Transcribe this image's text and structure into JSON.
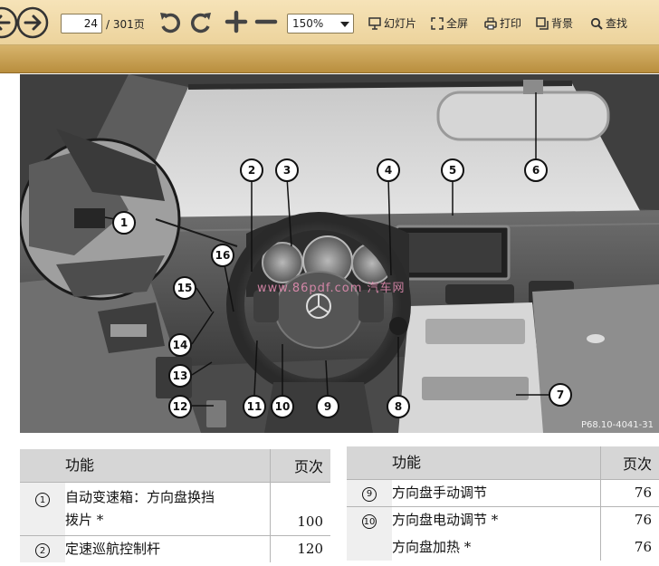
{
  "toolbar": {
    "page_current": "24",
    "page_total_label": "/ 301页",
    "zoom_value": "150%",
    "tools": {
      "slideshow": "幻灯片",
      "fullscreen": "全屏",
      "print": "打印",
      "background": "背景",
      "search": "查找"
    },
    "icons": [
      "back-icon",
      "forward-icon",
      "rotate-left-icon",
      "rotate-right-icon",
      "zoom-in-icon",
      "zoom-out-icon",
      "slideshow-icon",
      "fullscreen-icon",
      "print-icon",
      "background-icon",
      "search-icon"
    ]
  },
  "figure": {
    "code": "P68.10-4041-31",
    "watermark": "www.86pdf.com 汽车网",
    "callouts": [
      "1",
      "2",
      "3",
      "4",
      "5",
      "6",
      "7",
      "8",
      "9",
      "10",
      "11",
      "12",
      "13",
      "14",
      "15",
      "16"
    ]
  },
  "table_left": {
    "headers": [
      "功能",
      "页次"
    ],
    "rows": [
      {
        "num": "1",
        "text_lines": [
          "自动变速箱：方向盘换挡",
          "拨片 *"
        ],
        "page": "100"
      },
      {
        "num": "2",
        "text_lines": [
          "定速巡航控制杆"
        ],
        "page": "120"
      }
    ]
  },
  "table_right": {
    "headers": [
      "功能",
      "页次"
    ],
    "rows": [
      {
        "num": "9",
        "text_lines": [
          "方向盘手动调节"
        ],
        "page": "76"
      },
      {
        "num": "10",
        "text_lines": [
          "方向盘电动调节 *"
        ],
        "page": "76"
      },
      {
        "num": "",
        "text_lines": [
          "方向盘加热 *"
        ],
        "page": "76"
      }
    ]
  }
}
